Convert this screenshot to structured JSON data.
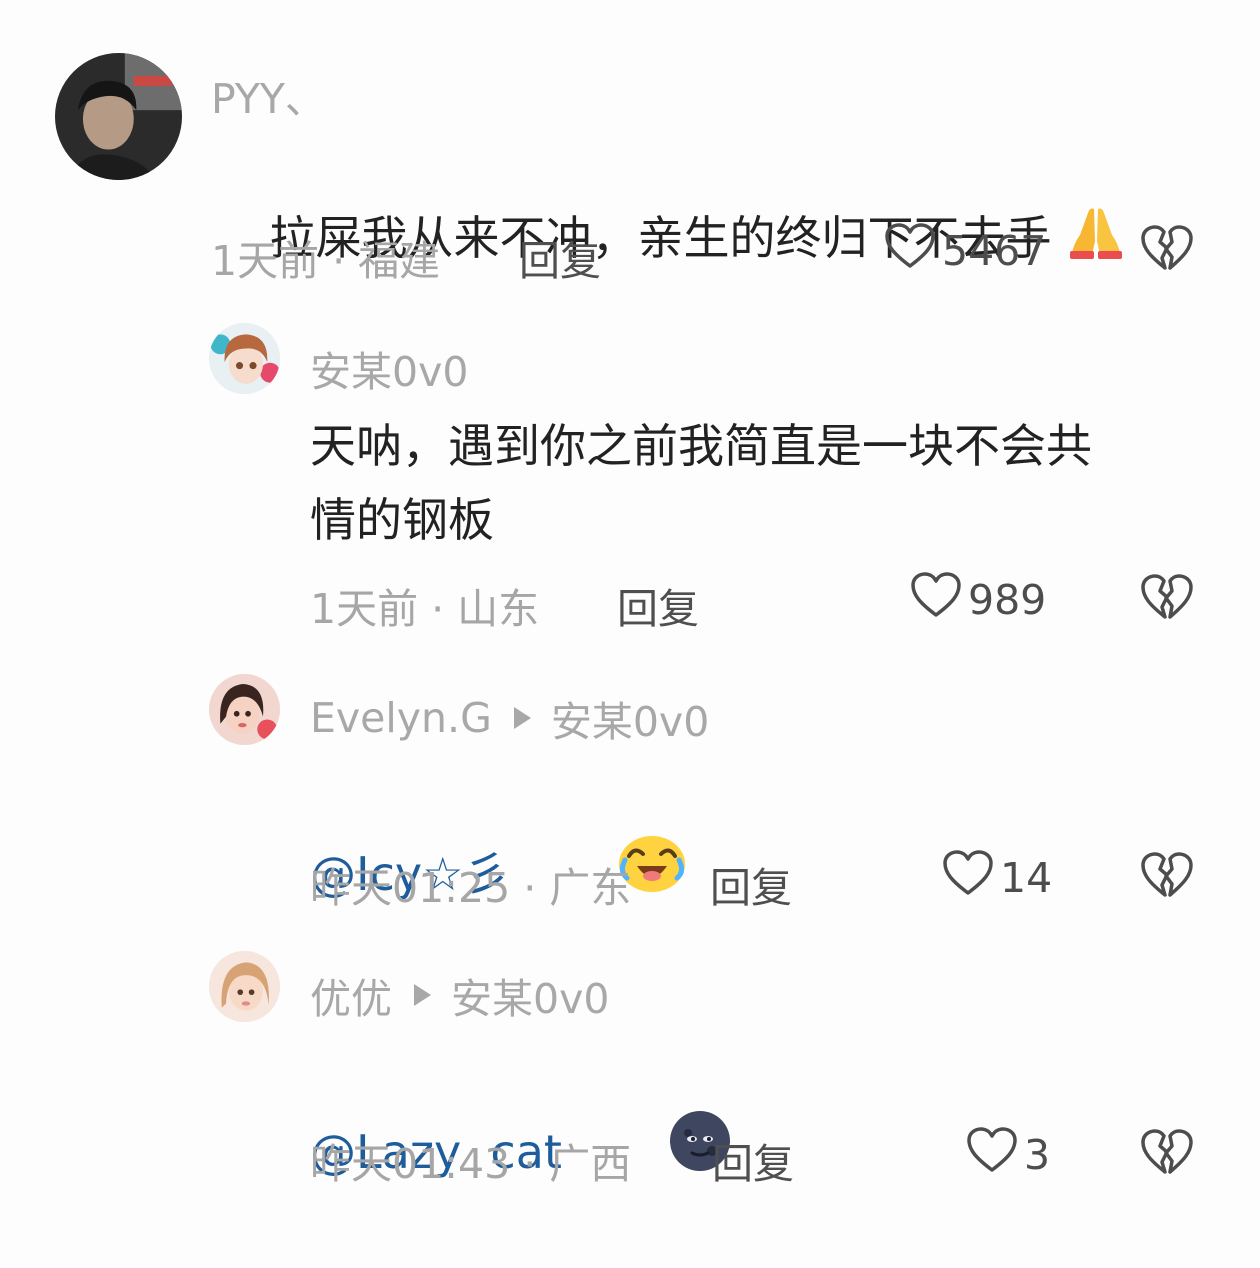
{
  "comments": [
    {
      "username": "PYY、",
      "text": "拉屎我从来不冲，亲生的终归下不去手",
      "emoji": "praying-hands-emoji",
      "time_location": "1天前 · 福建",
      "reply_label": "回复",
      "likes": "5467"
    },
    {
      "username": "安某0v0",
      "text": "天呐，遇到你之前我简直是一块不会共\n情的钢板",
      "time_location": "1天前 · 山东",
      "reply_label": "回复",
      "likes": "989"
    },
    {
      "username": "Evelyn.G",
      "reply_to": "安某0v0",
      "text": "@Icy☆彡",
      "emoji": "crying-laughing-face-emoji",
      "time_location": "昨天01:25 · 广东",
      "reply_label": "回复",
      "likes": "14"
    },
    {
      "username": "优优",
      "reply_to": "安某0v0",
      "text": "@Lazy  cat",
      "emoji": "new-moon-face-emoji",
      "time_location": "昨天01:43 · 广西",
      "reply_label": "回复",
      "likes": "3"
    }
  ],
  "icons": {
    "like": "heart-outline-icon",
    "dislike": "broken-heart-icon"
  },
  "colors": {
    "background": "#fdfdfd",
    "mention": "#1f5c9c",
    "secondary_text": "#a6a6a6"
  }
}
